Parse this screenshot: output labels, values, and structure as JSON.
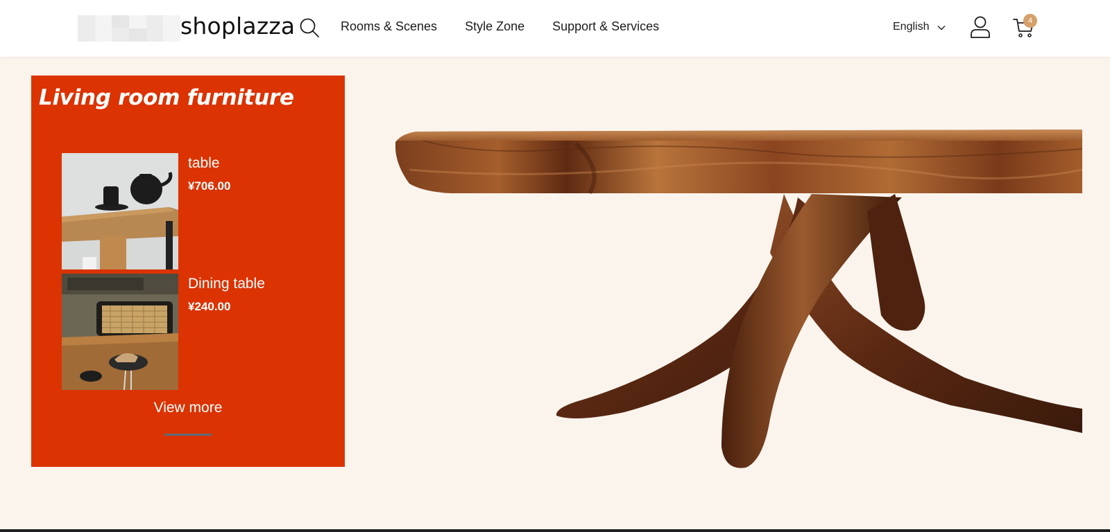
{
  "header": {
    "logo_text": "shoplazza",
    "nav": [
      "Rooms & Scenes",
      "Style Zone",
      "Support & Services"
    ],
    "language": "English",
    "cart_count": "4"
  },
  "promo": {
    "title": "Living room furniture",
    "products": [
      {
        "name": "table",
        "price": "¥706.00"
      },
      {
        "name": "Dining table",
        "price": "¥240.00"
      }
    ],
    "view_more": "View more"
  },
  "colors": {
    "accent": "#db3302",
    "page_bg": "#faf4ed",
    "badge": "#d6a06a"
  },
  "icons": [
    "search-icon",
    "chevron-down-icon",
    "user-icon",
    "cart-icon"
  ]
}
